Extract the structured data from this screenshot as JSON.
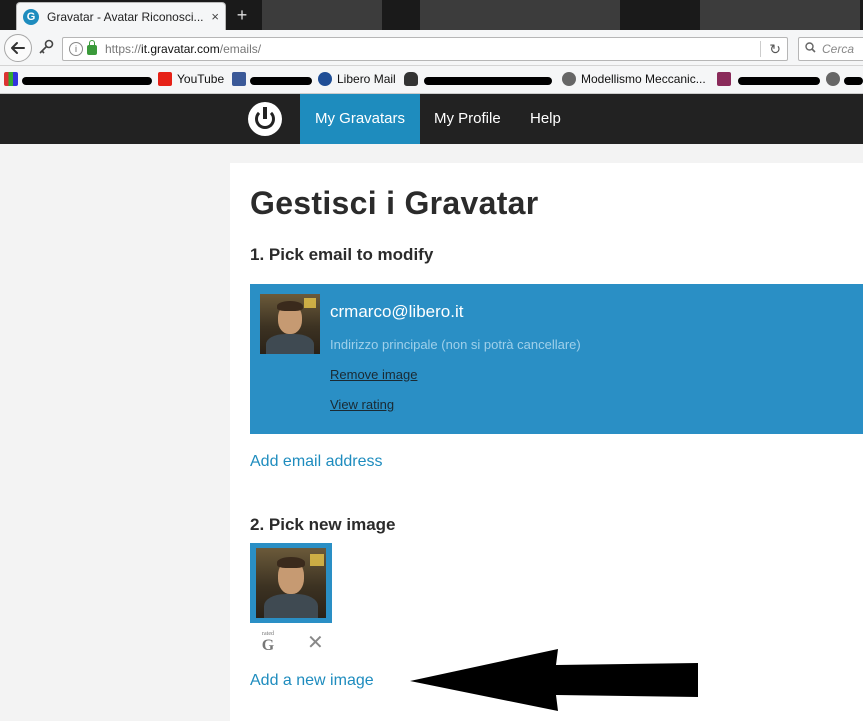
{
  "browser": {
    "tab_title": "Gravatar - Avatar Riconosci...",
    "tab_close": "×",
    "new_tab": "+",
    "url_scheme": "https://",
    "url_host": "it.gravatar.com",
    "url_path": "/emails/",
    "search_placeholder": "Cerca",
    "bookmarks": [
      {
        "label": "YouTube",
        "color": "#e62117"
      },
      {
        "label": "Libero Mail",
        "color": "#1f4e96"
      },
      {
        "label": "Modellismo Meccanic...",
        "color": "#666666"
      }
    ]
  },
  "gravatar": {
    "menu": [
      "My Gravatars",
      "My Profile",
      "Help"
    ],
    "page_title": "Gestisci i Gravatar",
    "step1": "1. Pick email to modify",
    "email": {
      "address": "crmarco@libero.it",
      "primary_note": "Indirizzo principale (non si potrà cancellare)",
      "remove_image": "Remove image",
      "view_rating": "View rating"
    },
    "add_email": "Add email address",
    "step2": "2. Pick new image",
    "rating": {
      "small": "rated",
      "big": "G"
    },
    "delete_glyph": "✕",
    "add_image": "Add a new image"
  },
  "colors": {
    "accent": "#1e8cbe",
    "card": "#2a8fc5",
    "header": "#222222"
  }
}
